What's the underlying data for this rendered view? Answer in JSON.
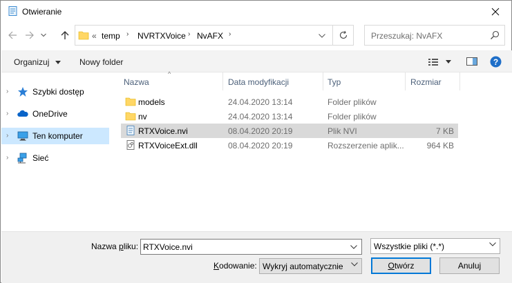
{
  "window": {
    "title": "Otwieranie"
  },
  "address": {
    "overflow": "«",
    "crumbs": [
      "temp",
      "NVRTXVoice",
      "NvAFX"
    ]
  },
  "search": {
    "placeholder": "Przeszukaj: NvAFX"
  },
  "toolbar": {
    "organize_label": "Organizuj",
    "new_folder_label": "Nowy folder"
  },
  "nav": {
    "items": [
      {
        "label": "Szybki dostęp",
        "icon": "star-icon"
      },
      {
        "label": "OneDrive",
        "icon": "cloud-icon"
      },
      {
        "label": "Ten komputer",
        "icon": "computer-icon",
        "selected": true
      },
      {
        "label": "Sieć",
        "icon": "network-icon"
      }
    ]
  },
  "columns": {
    "name": "Nazwa",
    "date": "Data modyfikacji",
    "type": "Typ",
    "size": "Rozmiar"
  },
  "files": [
    {
      "name": "models",
      "date": "24.04.2020 13:14",
      "type": "Folder plików",
      "size": "",
      "icon": "folder-icon"
    },
    {
      "name": "nv",
      "date": "24.04.2020 13:14",
      "type": "Folder plików",
      "size": "",
      "icon": "folder-icon"
    },
    {
      "name": "RTXVoice.nvi",
      "date": "08.04.2020 20:19",
      "type": "Plik NVI",
      "size": "7 KB",
      "icon": "file-icon",
      "selected": true
    },
    {
      "name": "RTXVoiceExt.dll",
      "date": "08.04.2020 20:19",
      "type": "Rozszerzenie aplik...",
      "size": "964 KB",
      "icon": "dll-file-icon"
    }
  ],
  "bottom": {
    "filename_label_pre": "Nazwa ",
    "filename_label_u": "p",
    "filename_label_post": "liku:",
    "filename_value": "RTXVoice.nvi",
    "filter_value": "Wszystkie pliki  (*.*)",
    "encoding_label_u": "K",
    "encoding_label_post": "odowanie:",
    "encoding_value": "Wykryj automatycznie",
    "open_label_u": "O",
    "open_label_post": "twórz",
    "cancel_label": "Anuluj"
  },
  "colors": {
    "accent": "#0078d7",
    "selection": "#cce8ff",
    "folder": "#ffd766"
  }
}
